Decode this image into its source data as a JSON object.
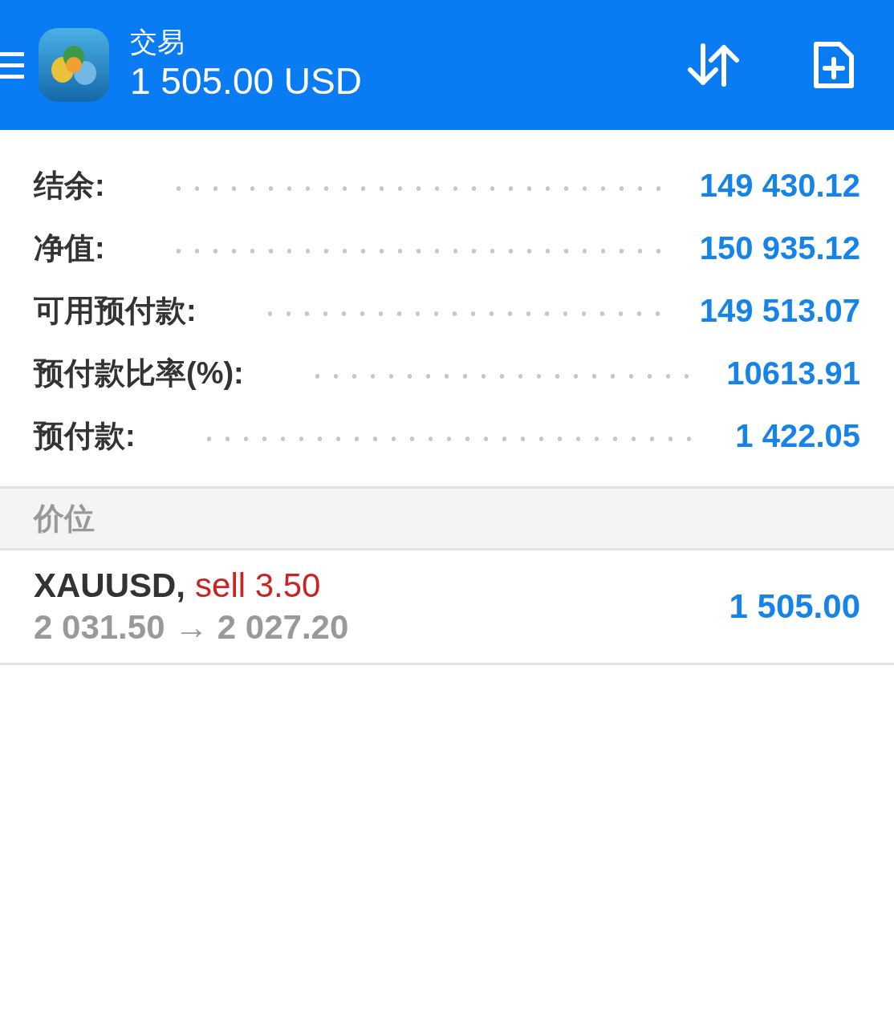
{
  "header": {
    "title": "交易",
    "balance": "1 505.00 USD"
  },
  "summary": [
    {
      "label": "结余:",
      "value": "149 430.12"
    },
    {
      "label": "净值:",
      "value": "150 935.12"
    },
    {
      "label": "可用预付款:",
      "value": "149 513.07"
    },
    {
      "label": "预付款比率(%):",
      "value": "10613.91"
    },
    {
      "label": "预付款:",
      "value": "1 422.05"
    }
  ],
  "section": {
    "title": "价位"
  },
  "positions": [
    {
      "symbol": "XAUUSD,",
      "type": "sell",
      "volume": "3.50",
      "prices": "2 031.50 → 2 027.20",
      "profit": "1 505.00"
    }
  ]
}
